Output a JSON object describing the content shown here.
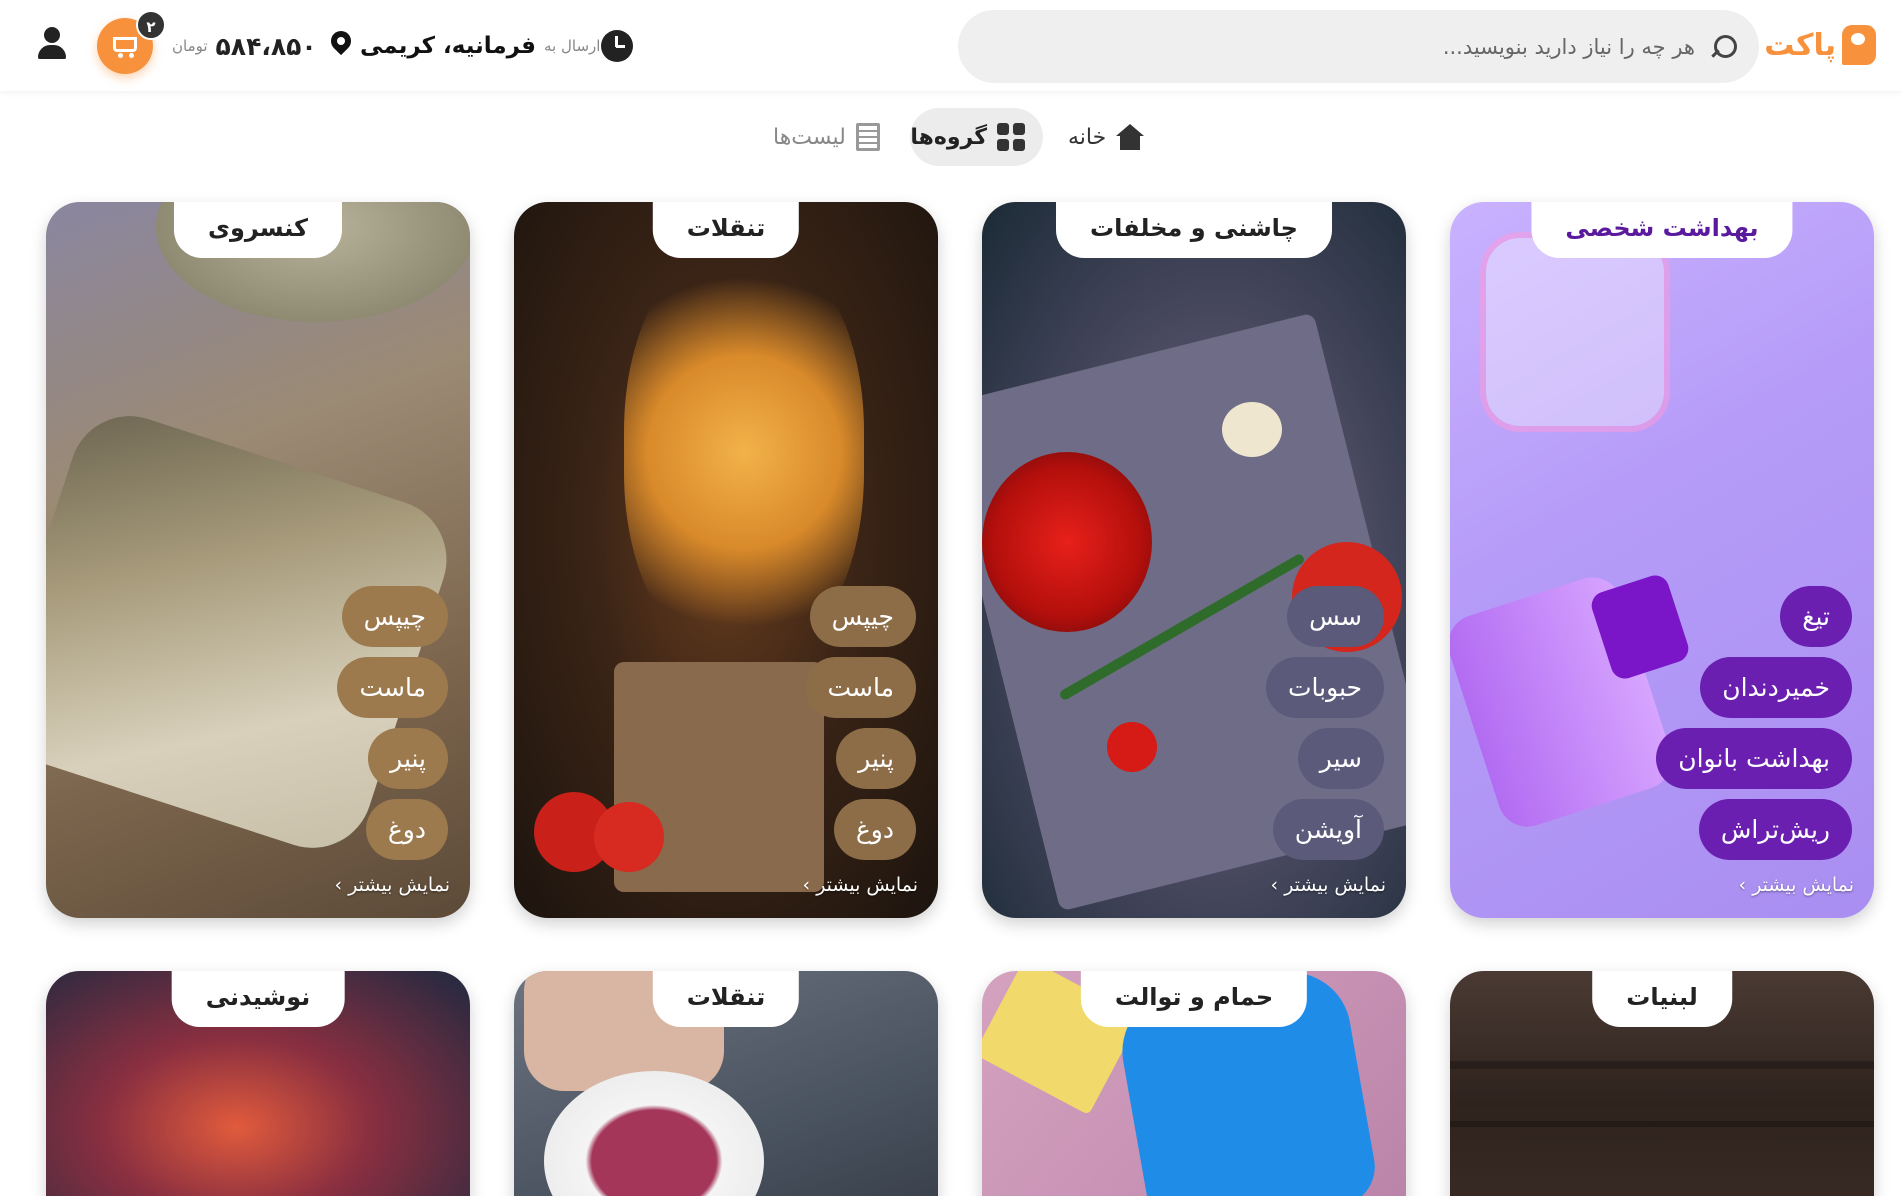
{
  "header": {
    "logo_text": "پاکت",
    "search_placeholder": "هر چه را نیاز دارید بنویسید...",
    "address_prefix": "ارسال به",
    "address_value": "فرمانیه، کریمی",
    "balance_value": "۵۸۴،۸۵۰",
    "balance_unit": "تومان",
    "cart_count": "۲",
    "accent_color": "#f7913c"
  },
  "nav": {
    "home": "خانه",
    "groups": "گروه‌ها",
    "lists": "لیست‌ها"
  },
  "cards": [
    {
      "title": "بهداشت شخصی",
      "title_color": "#5b1a9e",
      "chips": [
        "تیغ",
        "خمیردندان",
        "بهداشت بانوان",
        "ریش‌تراش"
      ],
      "chip_color": "#6a1fb0",
      "more": "نمایش بیشتر"
    },
    {
      "title": "چاشنی و مخلفات",
      "title_color": "#222222",
      "chips": [
        "سس",
        "حبوبات",
        "سیر",
        "آویشن"
      ],
      "chip_color": "#5c5a7a",
      "more": "نمایش بیشتر"
    },
    {
      "title": "تنقلات",
      "title_color": "#222222",
      "chips": [
        "چیپس",
        "ماست",
        "پنیر",
        "دوغ"
      ],
      "chip_color": "#8c6d47",
      "more": "نمایش بیشتر"
    },
    {
      "title": "کنسروی",
      "title_color": "#222222",
      "chips": [
        "چیپس",
        "ماست",
        "پنیر",
        "دوغ"
      ],
      "chip_color": "#9c7a4e",
      "more": "نمایش بیشتر"
    },
    {
      "title": "لبنیات"
    },
    {
      "title": "حمام و توالت"
    },
    {
      "title": "تنقلات"
    },
    {
      "title": "نوشیدنی"
    }
  ]
}
